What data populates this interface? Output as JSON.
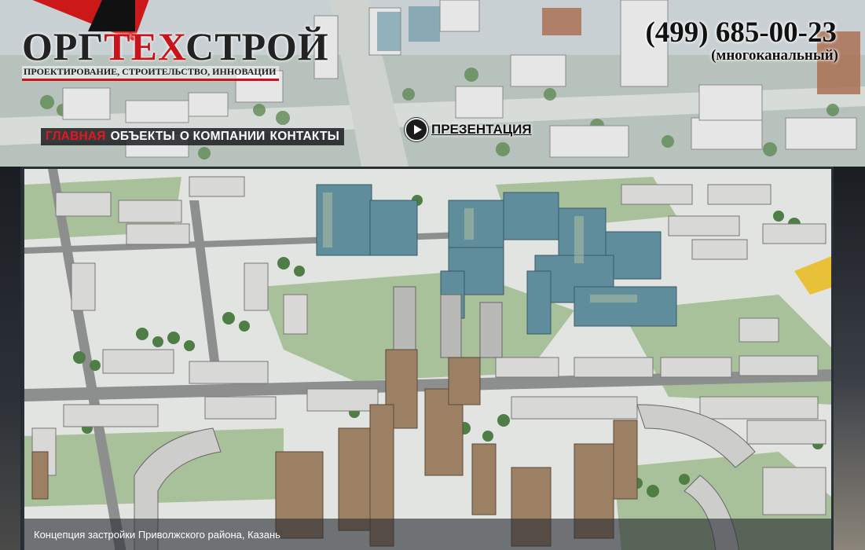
{
  "header": {
    "logo": {
      "text_part1": "ОРГ",
      "text_accent": "ТЕХ",
      "text_part2": "СТРОЙ",
      "tagline": "ПРОЕКТИРОВАНИЕ, СТРОИТЕЛЬСТВО, ИННОВАЦИИ"
    },
    "phone": {
      "number": "(499) 685-00-23",
      "note": "(многоканальный)"
    },
    "nav": [
      {
        "label": "ГЛАВНАЯ",
        "active": true
      },
      {
        "label": "ОБЪЕКТЫ",
        "active": false
      },
      {
        "label": "О КОМПАНИИ",
        "active": false
      },
      {
        "label": "КОНТАКТЫ",
        "active": false
      }
    ],
    "presentation": {
      "label": "ПРЕЗЕНТАЦИЯ",
      "icon": "play-circle-icon"
    }
  },
  "slider": {
    "caption": "Концепция застройки Приволжского района, Казань"
  },
  "colors": {
    "accent": "#c8141a",
    "nav_bg": "#14161a",
    "caption_bg": "#282c32"
  }
}
